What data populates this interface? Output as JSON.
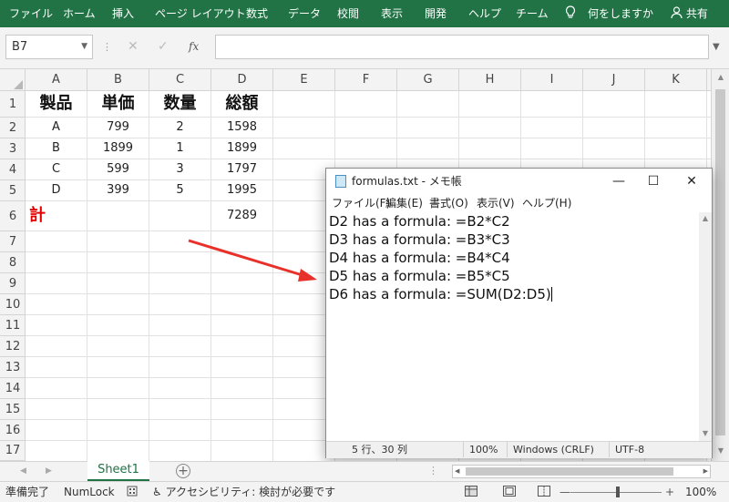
{
  "ribbon": {
    "tabs": [
      "ファイル",
      "ホーム",
      "挿入",
      "ページ レイアウト",
      "数式",
      "データ",
      "校閲",
      "表示",
      "開発",
      "ヘルプ",
      "チーム"
    ],
    "tell_me": "何をしますか",
    "share": "共有"
  },
  "formula_bar": {
    "name_box": "B7",
    "fx_label": "fx",
    "formula": ""
  },
  "columns": [
    "A",
    "B",
    "C",
    "D",
    "E",
    "F",
    "G",
    "H",
    "I",
    "J",
    "K"
  ],
  "rows": [
    "1",
    "2",
    "3",
    "4",
    "5",
    "6",
    "7",
    "8",
    "9",
    "10",
    "11",
    "12",
    "13",
    "14",
    "15",
    "16",
    "17"
  ],
  "table": {
    "headers": [
      "製品",
      "単価",
      "数量",
      "総額"
    ],
    "data": [
      [
        "A",
        "799",
        "2",
        "1598"
      ],
      [
        "B",
        "1899",
        "1",
        "1899"
      ],
      [
        "C",
        "599",
        "3",
        "1797"
      ],
      [
        "D",
        "399",
        "5",
        "1995"
      ]
    ],
    "total_label": "計",
    "total_value": "7289"
  },
  "sheet_tabs": {
    "active": "Sheet1"
  },
  "status_bar": {
    "ready": "準備完了",
    "numlock": "NumLock",
    "accessibility": "アクセシビリティ: 検討が必要です",
    "zoom": "100%"
  },
  "notepad": {
    "title": "formulas.txt - メモ帳",
    "menu": [
      "ファイル(F)",
      "編集(E)",
      "書式(O)",
      "表示(V)",
      "ヘルプ(H)"
    ],
    "lines": [
      "D2 has a formula: =B2*C2",
      "D3 has a formula: =B3*C3",
      "D4 has a formula: =B4*C4",
      "D5 has a formula: =B5*C5",
      "D6 has a formula: =SUM(D2:D5)"
    ],
    "status": {
      "position": "5 行、30 列",
      "zoom": "100%",
      "line_endings": "Windows (CRLF)",
      "encoding": "UTF-8"
    }
  },
  "colors": {
    "ribbon": "#217346",
    "total_label": "#e00000",
    "arrow": "#e8312a"
  }
}
